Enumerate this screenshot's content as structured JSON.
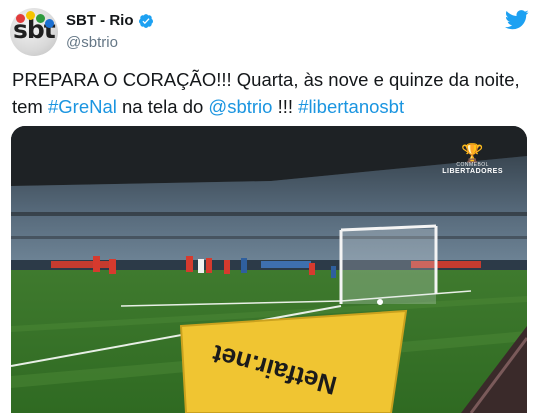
{
  "account": {
    "name": "SBT - Rio",
    "handle": "@sbtrio",
    "avatar_text": "sbt",
    "verified": true
  },
  "tweet": {
    "text_1": "PREPARA O CORAÇÃO!!! Quarta, às nove e quinze da noite,",
    "text_2": "tem ",
    "hashtag_grenal": "#GreNal",
    "text_3": " na tela do ",
    "mention": "@sbtrio",
    "text_4": " !!! ",
    "hashtag_libertanosbt": "#libertanosbt"
  },
  "media": {
    "competition_small": "CONMEBOL",
    "competition_big": "LIBERTADORES",
    "board_text": "Netfair.net"
  },
  "colors": {
    "link": "#1b95e0",
    "twitter_blue": "#1da1f2",
    "text": "#14171a",
    "secondary": "#657786"
  },
  "icons": {
    "verified": "verified-badge-icon",
    "twitter": "twitter-bird-icon"
  }
}
